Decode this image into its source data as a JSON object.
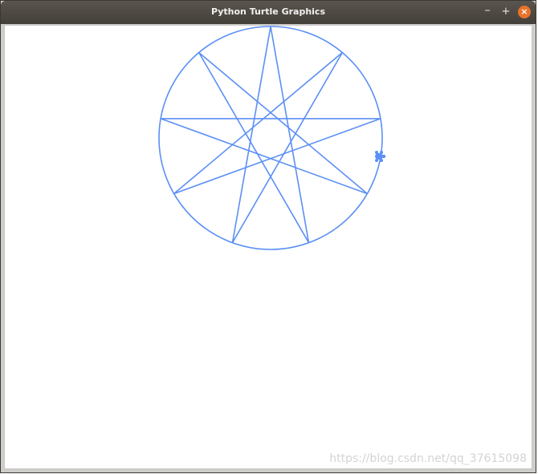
{
  "window": {
    "title": "Python Turtle Graphics",
    "controls": {
      "minimize": "–",
      "maximize": "+",
      "close": "×"
    }
  },
  "canvas": {
    "background": "#ffffff",
    "pen_color": "#5b8ff5",
    "drawing": "nine-point star polygram inscribed in a circle, turtle cursor at rightmost vertex"
  },
  "watermark": "https://blog.csdn.net/qq_37615098"
}
